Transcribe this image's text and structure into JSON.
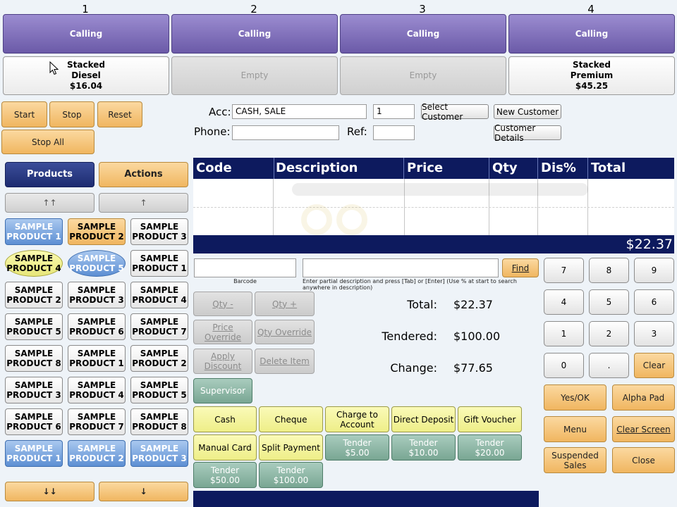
{
  "pumps": [
    {
      "number": "1",
      "status": "Calling",
      "body": [
        "Stacked",
        "Diesel",
        "$16.04"
      ],
      "empty": false
    },
    {
      "number": "2",
      "status": "Calling",
      "body": [
        "Empty"
      ],
      "empty": true
    },
    {
      "number": "3",
      "status": "Calling",
      "body": [
        "Empty"
      ],
      "empty": true
    },
    {
      "number": "4",
      "status": "Calling",
      "body": [
        "Stacked",
        "Premium",
        "$45.25"
      ],
      "empty": false
    }
  ],
  "pump_controls": {
    "start": "Start",
    "stop": "Stop",
    "reset": "Reset",
    "stop_all": "Stop All"
  },
  "tabs": {
    "products": "Products",
    "actions": "Actions"
  },
  "scroll": {
    "up_double": "↑↑",
    "up": "↑",
    "down_double": "↓↓",
    "down": "↓"
  },
  "products": [
    [
      {
        "label": "SAMPLE PRODUCT 1",
        "style": "blue"
      },
      {
        "label": "SAMPLE PRODUCT 2",
        "style": "orange"
      },
      {
        "label": "SAMPLE PRODUCT 3",
        "style": "white"
      }
    ],
    [
      {
        "label": "SAMPLE PRODUCT 4",
        "style": "yellow-oval"
      },
      {
        "label": "SAMPLE PRODUCT 5",
        "style": "blue-oval"
      },
      {
        "label": "SAMPLE PRODUCT 1",
        "style": "white"
      }
    ],
    [
      {
        "label": "SAMPLE PRODUCT 2",
        "style": "white"
      },
      {
        "label": "SAMPLE PRODUCT 3",
        "style": "white"
      },
      {
        "label": "SAMPLE PRODUCT 4",
        "style": "white"
      }
    ],
    [
      {
        "label": "SAMPLE PRODUCT 5",
        "style": "white"
      },
      {
        "label": "SAMPLE PRODUCT 6",
        "style": "white"
      },
      {
        "label": "SAMPLE PRODUCT 7",
        "style": "white"
      }
    ],
    [
      {
        "label": "SAMPLE PRODUCT 8",
        "style": "white"
      },
      {
        "label": "SAMPLE PRODUCT 1",
        "style": "white"
      },
      {
        "label": "SAMPLE PRODUCT 2",
        "style": "white"
      }
    ],
    [
      {
        "label": "SAMPLE PRODUCT 3",
        "style": "white"
      },
      {
        "label": "SAMPLE PRODUCT 4",
        "style": "white"
      },
      {
        "label": "SAMPLE PRODUCT 5",
        "style": "white"
      }
    ],
    [
      {
        "label": "SAMPLE PRODUCT 6",
        "style": "white"
      },
      {
        "label": "SAMPLE PRODUCT 7",
        "style": "white"
      },
      {
        "label": "SAMPLE PRODUCT 8",
        "style": "white"
      }
    ],
    [
      {
        "label": "SAMPLE PRODUCT 1",
        "style": "blue"
      },
      {
        "label": "SAMPLE PRODUCT 2",
        "style": "blue"
      },
      {
        "label": "SAMPLE PRODUCT 3",
        "style": "blue"
      }
    ]
  ],
  "customer": {
    "acc_label": "Acc:",
    "acc_value": "CASH, SALE",
    "acc_qty": "1",
    "phone_label": "Phone:",
    "phone_value": "",
    "ref_label": "Ref:",
    "ref_value": "",
    "select_customer": "Select Customer",
    "new_customer": "New Customer",
    "customer_details": "Customer Details"
  },
  "table": {
    "headers": [
      "Code",
      "Description",
      "Price",
      "Qty",
      "Dis%",
      "Total"
    ],
    "rows": [],
    "total": "$22.37"
  },
  "search": {
    "barcode_label": "Barcode",
    "find": "Find",
    "hint": "Enter partial description and press [Tab] or [Enter] (Use % at start to search anywhere in description)"
  },
  "actions": {
    "qty_minus": "Qty -",
    "qty_plus": "Qty +",
    "price_override": "Price Override",
    "qty_override": "Qty Override",
    "apply_discount": "Apply Discount",
    "delete_item": "Delete Item",
    "supervisor": "Supervisor"
  },
  "summary": {
    "total_label": "Total:",
    "total_value": "$22.37",
    "tendered_label": "Tendered:",
    "tendered_value": "$100.00",
    "change_label": "Change:",
    "change_value": "$77.65"
  },
  "tender": {
    "cash": "Cash",
    "cheque": "Cheque",
    "charge_to_account": "Charge to Account",
    "direct_deposit": "Direct Deposit",
    "gift_voucher": "Gift Voucher",
    "manual_card": "Manual Card",
    "split_payment": "Split Payment",
    "quick": [
      {
        "line1": "Tender",
        "line2": "$5.00"
      },
      {
        "line1": "Tender",
        "line2": "$10.00"
      },
      {
        "line1": "Tender",
        "line2": "$20.00"
      },
      {
        "line1": "Tender",
        "line2": "$50.00"
      },
      {
        "line1": "Tender",
        "line2": "$100.00"
      }
    ]
  },
  "keypad": {
    "keys": [
      "7",
      "8",
      "9",
      "4",
      "5",
      "6",
      "1",
      "2",
      "3",
      "0",
      "."
    ],
    "clear": "Clear",
    "yes_ok": "Yes/OK",
    "alpha_pad": "Alpha Pad",
    "menu": "Menu",
    "clear_screen": "Clear Screen",
    "suspended_sales": "Suspended Sales",
    "close": "Close"
  },
  "colors": {
    "accent_navy": "#0d1a5e",
    "pump_purple": "#6b5aa8",
    "orange": "#f0b660"
  }
}
